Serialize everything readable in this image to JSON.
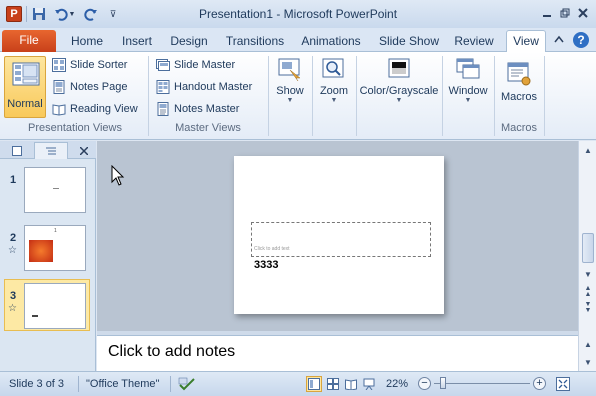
{
  "window": {
    "title": "Presentation1 - Microsoft PowerPoint",
    "app_icon_letter": "P"
  },
  "tabs": {
    "file": "File",
    "items": [
      "Home",
      "Insert",
      "Design",
      "Transitions",
      "Animations",
      "Slide Show",
      "Review",
      "View"
    ],
    "active": "View"
  },
  "ribbon": {
    "presentation_views": {
      "label": "Presentation Views",
      "normal": "Normal",
      "slide_sorter": "Slide Sorter",
      "notes_page": "Notes Page",
      "reading_view": "Reading View"
    },
    "master_views": {
      "label": "Master Views",
      "slide_master": "Slide Master",
      "handout_master": "Handout Master",
      "notes_master": "Notes Master"
    },
    "show": "Show",
    "zoom": "Zoom",
    "color_grayscale": "Color/Grayscale",
    "window": "Window",
    "macros": {
      "button": "Macros",
      "label": "Macros"
    }
  },
  "slides_pane": {
    "thumbnails": [
      {
        "number": "1",
        "has_transition": false
      },
      {
        "number": "2",
        "has_transition": true,
        "page_marker": "1"
      },
      {
        "number": "3",
        "has_transition": true,
        "selected": true
      }
    ]
  },
  "slide": {
    "placeholder_hint": "Click to add text",
    "text": "3333"
  },
  "notes": {
    "placeholder": "Click to add notes"
  },
  "status": {
    "slide_info": "Slide 3 of 3",
    "theme": "\"Office Theme\"",
    "zoom": "22%"
  },
  "colors": {
    "accent": "#c8401a",
    "active_highlight": "#f9c95a",
    "ribbon_bg": "#dbe6f4"
  }
}
